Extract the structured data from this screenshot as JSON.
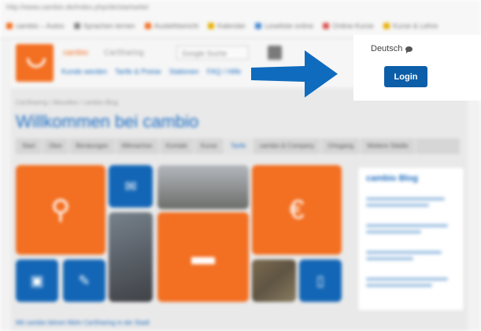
{
  "browser": {
    "url": "http://www.cambio.de/index.php/de/startseite/",
    "bookmarks": [
      {
        "label": "cambio – Autos",
        "color": "#f36f21"
      },
      {
        "label": "Sprachen lernen",
        "color": "#888888"
      },
      {
        "label": "Ausleihbericht",
        "color": "#f36f21"
      },
      {
        "label": "Kalender",
        "color": "#e8b000"
      },
      {
        "label": "Leseliste online",
        "color": "#4a8bd0"
      },
      {
        "label": "Online-Kurse",
        "color": "#d9534f"
      },
      {
        "label": "Kurse & Lehre",
        "color": "#e8b000"
      }
    ]
  },
  "site": {
    "brand": "cambio",
    "brand_sub": "CarSharing",
    "search_placeholder": "Google Suche",
    "top_nav": [
      "Kunde werden",
      "Tarife & Preise",
      "Stationen",
      "FAQ / Hilfe"
    ],
    "breadcrumb": "CarSharing / Aktuelles / cambio Blog",
    "welcome": "Willkommen bei cambio",
    "tabs": [
      "Start",
      "Über",
      "Beratungen",
      "Mitmachen",
      "Kontakt",
      "Kurse",
      "Tarife",
      "cambio & Company",
      "Ortsgang",
      "Weitere Städte"
    ],
    "active_tab": "Tarife",
    "blog_title": "cambio Blog",
    "footer_links": "Mit cambio fahren     Mehr CarSharing in der Stadt"
  },
  "popup": {
    "language": "Deutsch",
    "language_icon": "speech-bubble-icon",
    "login_label": "Login"
  },
  "colors": {
    "orange": "#f36f21",
    "blue": "#1366b6",
    "login_bg": "#0d5ea8",
    "arrow": "#0f6bbd",
    "heading_blue": "#1a6cc4"
  },
  "icons": {
    "tile_pin": "location-pin-icon",
    "tile_euro": "euro-icon",
    "tile_car": "car-icon",
    "tile_chat": "speech-bubble-icon",
    "tile_pen": "pen-icon",
    "tile_phone": "mobile-phone-icon",
    "tile_card": "card-icon"
  }
}
